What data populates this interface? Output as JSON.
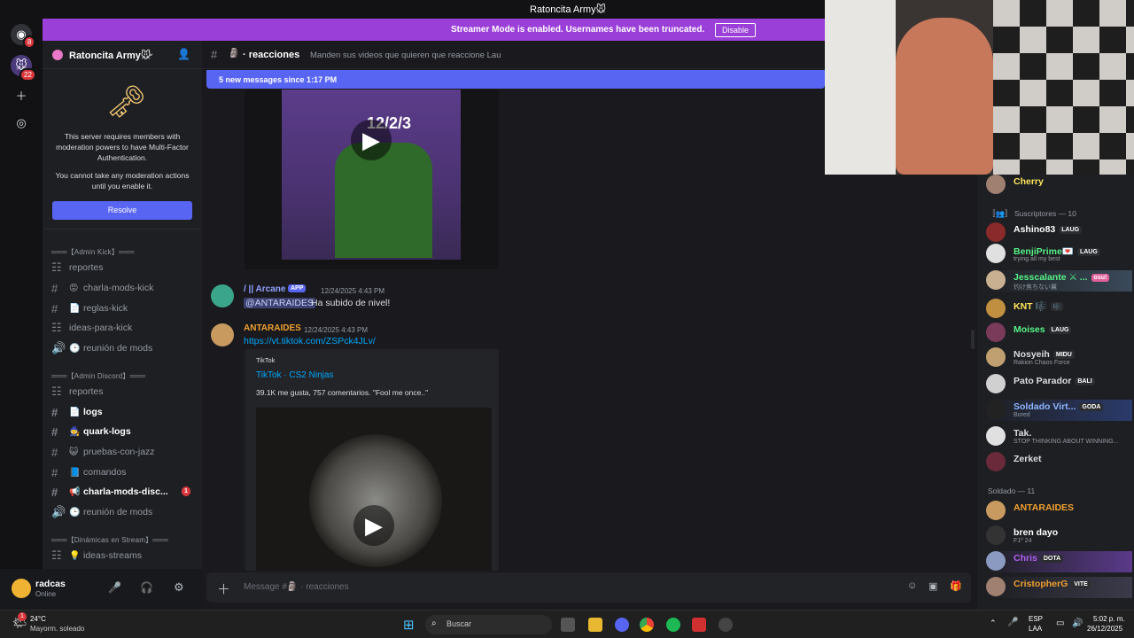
{
  "window": {
    "title": "Ratoncita Army🐭"
  },
  "rail": {
    "home_badge": "8",
    "server_badge": "22"
  },
  "banner": {
    "message": "Streamer Mode is enabled. Usernames have been truncated.",
    "disable_label": "Disable"
  },
  "server": {
    "name": "Ratoncita Army🐭",
    "mfa_text_1": "This server requires members with moderation powers to have Multi-Factor Authentication.",
    "mfa_text_2": "You cannot take any moderation actions until you enable it.",
    "resolve_label": "Resolve"
  },
  "sidebar": {
    "categories": [
      "═══【Admin Kick】═══",
      "═══【Admin Discord】═══",
      "═══【Dinámicas en Stream】═══"
    ],
    "channels": [
      {
        "label": "reportes",
        "icon": "forum"
      },
      {
        "label": "charla-mods-kick",
        "icon": "hash",
        "emoji": "😡"
      },
      {
        "label": "reglas-kick",
        "icon": "hash",
        "emoji": "📄"
      },
      {
        "label": "ideas-para-kick",
        "icon": "forum"
      },
      {
        "label": "reunión de mods",
        "icon": "voice",
        "emoji": "🕒"
      },
      {
        "label": "reportes",
        "icon": "forum"
      },
      {
        "label": "logs",
        "icon": "hash",
        "emoji": "📄"
      },
      {
        "label": "quark-logs",
        "icon": "hash",
        "emoji": "🧙"
      },
      {
        "label": "pruebas-con-jazz",
        "icon": "hash",
        "emoji": "😺"
      },
      {
        "label": "comandos",
        "icon": "hash",
        "emoji": "📘"
      },
      {
        "label": "charla-mods-disc...",
        "icon": "hash",
        "emoji": "📢",
        "badge": "1"
      },
      {
        "label": "reunión de mods",
        "icon": "voice",
        "emoji": "🕒"
      },
      {
        "label": "ideas-streams",
        "icon": "forum",
        "emoji": "💡"
      }
    ]
  },
  "user": {
    "name": "radcas",
    "status": "Online"
  },
  "channel": {
    "name": "reacciones",
    "topic": "Manden sus videos que quieren que reaccione Lau",
    "new_messages": "5 new messages since 1:17 PM",
    "composer_placeholder": "Message #🗿 · reacciones"
  },
  "messages": [
    {
      "author": "/ || Arcane",
      "app_tag": "APP",
      "timestamp": "12/24/2025 4:43 PM",
      "mention": "@ANTARAIDES",
      "text": "Ha subido de nivel!"
    },
    {
      "author": "ANTARAIDES",
      "timestamp": "12/24/2025 4:43 PM",
      "link": "https://vt.tiktok.com/ZSPck4JLv/",
      "embed": {
        "provider": "TikTok",
        "title": "TikTok · CS2 Ninjas",
        "description": "39.1K me gusta, 757 comentarios. \"Fool me once..\""
      }
    }
  ],
  "video_overlay_text": "12/2/3",
  "members": {
    "top": {
      "name": "Cherry"
    },
    "groups": [
      {
        "label": "Suscriptores — 10",
        "members": [
          {
            "name": "Ashino83",
            "tag": "LAUG",
            "color": "#ffffff"
          },
          {
            "name": "BenjiPrime💌",
            "tag": "LAUG",
            "status": "trying all my best",
            "color": "#57f287"
          },
          {
            "name": "Jesscalante ⚔ ...",
            "tag": "osu!",
            "status": "灼け焦ちない翼",
            "color": "#57f287"
          },
          {
            "name": "KNT 🎼",
            "tag": "🎼",
            "color": "#fee75c"
          },
          {
            "name": "Moises",
            "tag": "LAUG",
            "color": "#57f287"
          },
          {
            "name": "Nosyeih",
            "tag": "MIDU",
            "status": "Rakion Chaos Force",
            "color": "#dbdee1"
          },
          {
            "name": "Pato Parador",
            "tag": "BALI",
            "color": "#dbdee1"
          },
          {
            "name": "Soldado Virt...",
            "tag": "GODA",
            "status": "Bored",
            "color": "#8fb5ff"
          },
          {
            "name": "Tak.",
            "status": "STOP THINKING ABOUT WINNING...",
            "color": "#dbdee1"
          },
          {
            "name": "Zerket",
            "color": "#dbdee1"
          }
        ]
      },
      {
        "label": "Soldado — 11",
        "members": [
          {
            "name": "ANTARAIDES",
            "color": "#f0a030"
          },
          {
            "name": "bren dayo",
            "status": "F1º 24",
            "color": "#ffffff"
          },
          {
            "name": "Chris",
            "tag": "DOTA",
            "color": "#b060f0"
          },
          {
            "name": "CristopherG",
            "tag": "VITE",
            "color": "#f0a030"
          }
        ]
      }
    ]
  },
  "taskbar": {
    "weather_temp": "24°C",
    "weather_desc": "Mayorm. soleado",
    "weather_badge": "1",
    "search_placeholder": "Buscar",
    "lang": "ESP",
    "lang_sub": "LAA",
    "time": "5:02 p. m.",
    "date": "26/12/2025"
  }
}
